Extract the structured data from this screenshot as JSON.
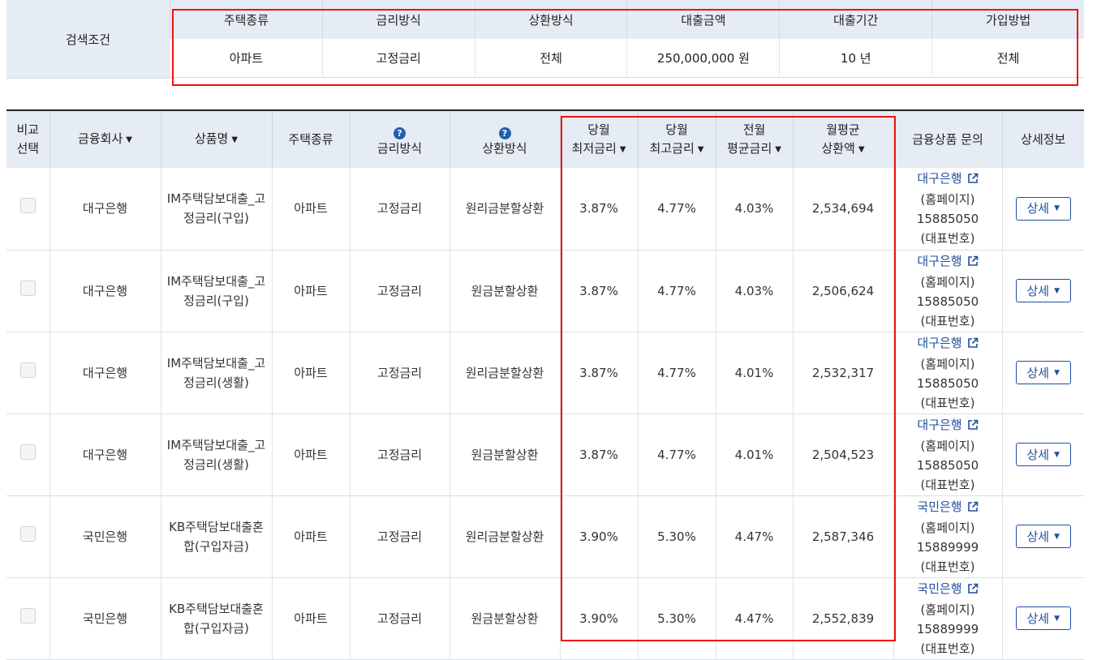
{
  "search": {
    "label": "검색조건",
    "headers": [
      "주택종류",
      "금리방식",
      "상환방식",
      "대출금액",
      "대출기간",
      "가입방법"
    ],
    "values": [
      "아파트",
      "고정금리",
      "전체",
      "250,000,000 원",
      "10 년",
      "전체"
    ]
  },
  "table": {
    "headers": {
      "compare": "비교\n선택",
      "company": "금융회사",
      "product": "상품명",
      "house": "주택종류",
      "rate_type": "금리방식",
      "repay": "상환방식",
      "min_rate": "당월\n최저금리",
      "max_rate": "당월\n최고금리",
      "avg_rate": "전월\n평균금리",
      "monthly": "월평균\n상환액",
      "inquiry": "금융상품 문의",
      "detail": "상세정보"
    },
    "help_glyph": "?",
    "sort_glyph": "▼",
    "rows": [
      {
        "company": "대구은행",
        "product": "IM주택담보대출_고정금리(구입)",
        "house": "아파트",
        "rate_type": "고정금리",
        "repay": "원리금분할상환",
        "min": "3.87%",
        "max": "4.77%",
        "avg": "4.03%",
        "monthly": "2,534,694",
        "bank_link": "대구은행",
        "homepage": "(홈페이지)",
        "phone": "15885050",
        "phone_label": "(대표번호)",
        "detail": "상세"
      },
      {
        "company": "대구은행",
        "product": "IM주택담보대출_고정금리(구입)",
        "house": "아파트",
        "rate_type": "고정금리",
        "repay": "원금분할상환",
        "min": "3.87%",
        "max": "4.77%",
        "avg": "4.03%",
        "monthly": "2,506,624",
        "bank_link": "대구은행",
        "homepage": "(홈페이지)",
        "phone": "15885050",
        "phone_label": "(대표번호)",
        "detail": "상세"
      },
      {
        "company": "대구은행",
        "product": "IM주택담보대출_고정금리(생활)",
        "house": "아파트",
        "rate_type": "고정금리",
        "repay": "원리금분할상환",
        "min": "3.87%",
        "max": "4.77%",
        "avg": "4.01%",
        "monthly": "2,532,317",
        "bank_link": "대구은행",
        "homepage": "(홈페이지)",
        "phone": "15885050",
        "phone_label": "(대표번호)",
        "detail": "상세"
      },
      {
        "company": "대구은행",
        "product": "IM주택담보대출_고정금리(생활)",
        "house": "아파트",
        "rate_type": "고정금리",
        "repay": "원금분할상환",
        "min": "3.87%",
        "max": "4.77%",
        "avg": "4.01%",
        "monthly": "2,504,523",
        "bank_link": "대구은행",
        "homepage": "(홈페이지)",
        "phone": "15885050",
        "phone_label": "(대표번호)",
        "detail": "상세"
      },
      {
        "company": "국민은행",
        "product": "KB주택담보대출혼합(구입자금)",
        "house": "아파트",
        "rate_type": "고정금리",
        "repay": "원리금분할상환",
        "min": "3.90%",
        "max": "5.30%",
        "avg": "4.47%",
        "monthly": "2,587,346",
        "bank_link": "국민은행",
        "homepage": "(홈페이지)",
        "phone": "15889999",
        "phone_label": "(대표번호)",
        "detail": "상세"
      },
      {
        "company": "국민은행",
        "product": "KB주택담보대출혼합(구입자금)",
        "house": "아파트",
        "rate_type": "고정금리",
        "repay": "원금분할상환",
        "min": "3.90%",
        "max": "5.30%",
        "avg": "4.47%",
        "monthly": "2,552,839",
        "bank_link": "국민은행",
        "homepage": "(홈페이지)",
        "phone": "15889999",
        "phone_label": "(대표번호)",
        "detail": "상세"
      }
    ]
  },
  "colors": {
    "header_bg": "#e6ecf3",
    "link": "#1f4fa0",
    "highlight_box": "#ee1111"
  }
}
